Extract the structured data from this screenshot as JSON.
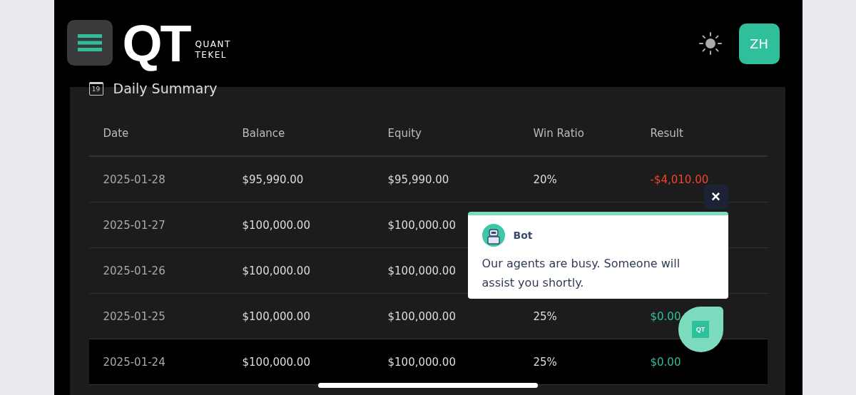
{
  "header": {
    "logo_mark": "QT",
    "logo_text": [
      "QUANT",
      "TEKEL"
    ],
    "avatar": "ZH"
  },
  "summary": {
    "title": "Daily Summary",
    "calendar_day": "19",
    "columns": [
      "Date",
      "Balance",
      "Equity",
      "Win Ratio",
      "Result"
    ],
    "rows": [
      {
        "date": "2025-01-28",
        "balance": "$95,990.00",
        "equity": "$95,990.00",
        "win_ratio": "20%",
        "result": "-$4,010.00",
        "color": "#f0452a",
        "selected": false
      },
      {
        "date": "2025-01-27",
        "balance": "$100,000.00",
        "equity": "$100,000.00",
        "selected": false
      },
      {
        "date": "2025-01-26",
        "balance": "$100,000.00",
        "equity": "$100,000.00",
        "selected": false
      },
      {
        "date": "2025-01-25",
        "balance": "$100,000.00",
        "equity": "$100,000.00",
        "win_ratio": "25%",
        "result": "$0.00",
        "color": "#2fbf9b",
        "selected": false
      },
      {
        "date": "2025-01-24",
        "balance": "$100,000.00",
        "equity": "$100,000.00",
        "win_ratio": "25%",
        "result": "$0.00",
        "color": "#2fbf9b",
        "selected": true
      }
    ]
  },
  "chat": {
    "sender": "Bot",
    "message": "Our agents are busy. Someone will assist you shortly.",
    "close": "×",
    "launcher_badge": "QT"
  }
}
